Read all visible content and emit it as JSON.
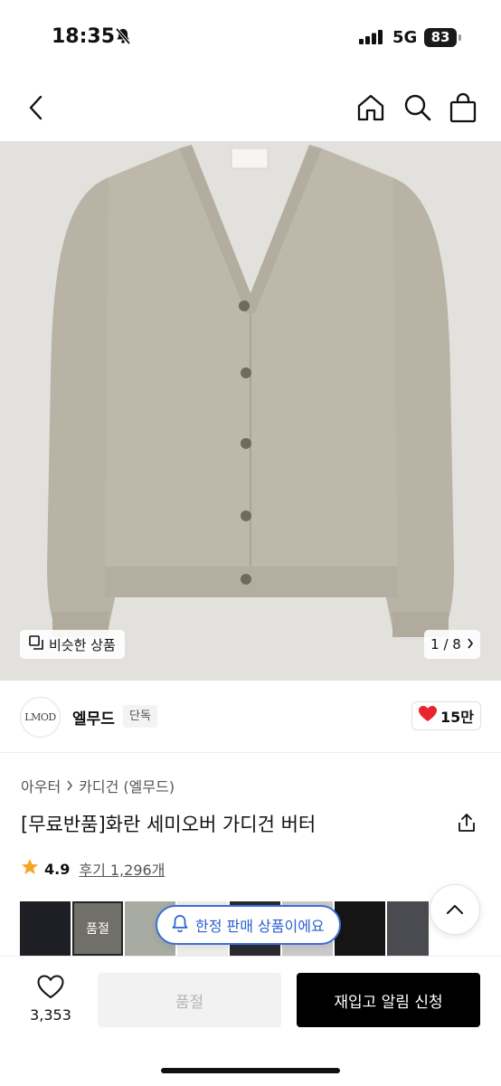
{
  "status_bar": {
    "time": "18:35",
    "network": "5G",
    "battery": "83",
    "icons": [
      "bell-slash-icon",
      "signal-icon",
      "battery-icon"
    ]
  },
  "nav": {
    "icons": [
      "back-chevron-icon",
      "home-icon",
      "search-icon",
      "shopping-bag-icon"
    ]
  },
  "gallery": {
    "similar_label": "비슷한 상품",
    "page_indicator": "1 / 8",
    "colors": {
      "background": "#e3e1dd",
      "cardigan": "#bdb8aa"
    }
  },
  "brand": {
    "logo_text": "LMOD",
    "name": "엘무드",
    "tag": "단독",
    "likes": "15만",
    "like_color": "#e8242d"
  },
  "product": {
    "breadcrumb": [
      "아우터",
      "카디건 (엘무드)"
    ],
    "title": "[무료반품]화란 세미오버 가디건 버터",
    "rating": "4.9",
    "reviews": "후기 1,296개",
    "star_color": "#f5a623"
  },
  "variants": {
    "soldout_label": "품절",
    "limited_badge": "한정 판매 상품이에요",
    "accent": "#3b6fd8",
    "thumb_colors": [
      "#1d1f24",
      "#9d9a8f",
      "#a7aba2",
      "#ececea",
      "#2a2b30",
      "#c9c9c9",
      "#151515",
      "#4a4b50"
    ]
  },
  "bottom_bar": {
    "wish_count": "3,353",
    "soldout_button": "품절",
    "restock_button": "재입고 알림 신청"
  }
}
